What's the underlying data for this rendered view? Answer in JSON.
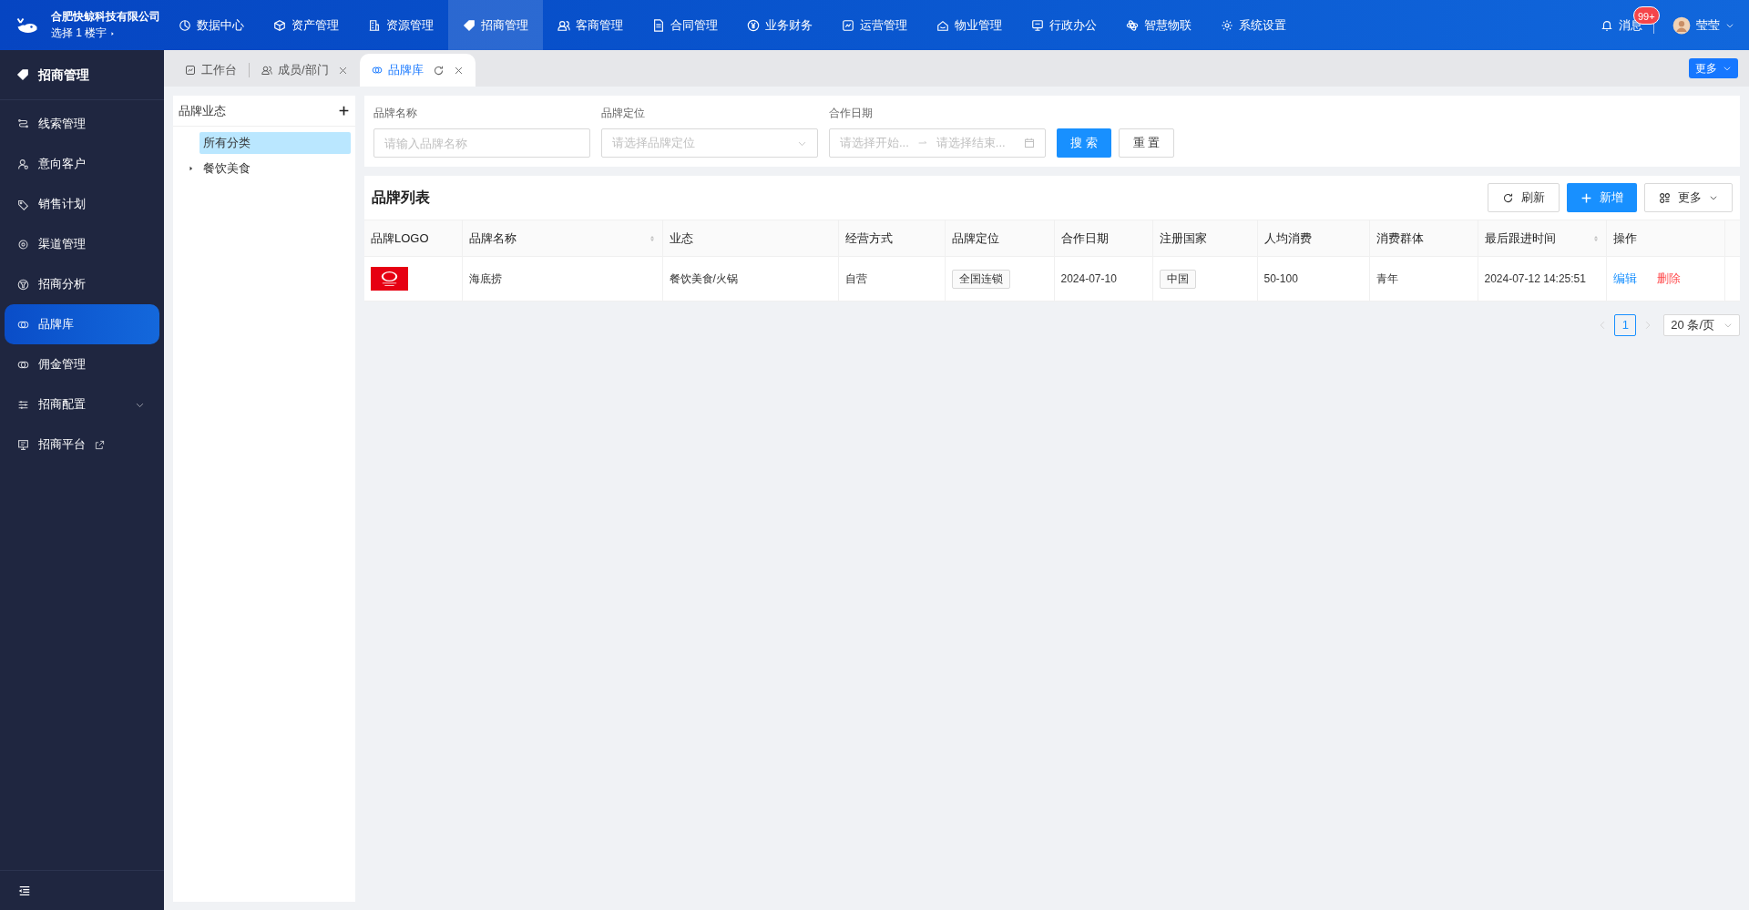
{
  "header": {
    "company": "合肥快鲸科技有限公司",
    "building_select": "选择 1 楼宇",
    "nav": [
      {
        "label": "数据中心",
        "selected": false
      },
      {
        "label": "资产管理",
        "selected": false
      },
      {
        "label": "资源管理",
        "selected": false
      },
      {
        "label": "招商管理",
        "selected": true
      },
      {
        "label": "客商管理",
        "selected": false
      },
      {
        "label": "合同管理",
        "selected": false
      },
      {
        "label": "业务财务",
        "selected": false
      },
      {
        "label": "运营管理",
        "selected": false
      },
      {
        "label": "物业管理",
        "selected": false
      },
      {
        "label": "行政办公",
        "selected": false
      },
      {
        "label": "智慧物联",
        "selected": false
      },
      {
        "label": "系统设置",
        "selected": false
      }
    ],
    "messages": "消息",
    "badge": "99+",
    "user": "莹莹"
  },
  "sidebar": {
    "title": "招商管理",
    "items": [
      {
        "label": "线索管理",
        "selected": false,
        "kind": "plain"
      },
      {
        "label": "意向客户",
        "selected": false,
        "kind": "plain"
      },
      {
        "label": "销售计划",
        "selected": false,
        "kind": "plain"
      },
      {
        "label": "渠道管理",
        "selected": false,
        "kind": "plain"
      },
      {
        "label": "招商分析",
        "selected": false,
        "kind": "plain"
      },
      {
        "label": "品牌库",
        "selected": true,
        "kind": "plain"
      },
      {
        "label": "佣金管理",
        "selected": false,
        "kind": "plain"
      },
      {
        "label": "招商配置",
        "selected": false,
        "kind": "expandable"
      },
      {
        "label": "招商平台",
        "selected": false,
        "kind": "external"
      }
    ]
  },
  "tabs": [
    {
      "label": "工作台",
      "selected": false,
      "closable": false
    },
    {
      "label": "成员/部门",
      "selected": false,
      "closable": true
    },
    {
      "label": "品牌库",
      "selected": true,
      "closable": true
    }
  ],
  "tabs_more": "更多",
  "tree": {
    "title": "品牌业态",
    "items": [
      {
        "label": "所有分类",
        "selected": true,
        "expandable": false
      },
      {
        "label": "餐饮美食",
        "selected": false,
        "expandable": true
      }
    ]
  },
  "search": {
    "fields": [
      {
        "label": "品牌名称",
        "kind": "input",
        "placeholder": "请输入品牌名称"
      },
      {
        "label": "品牌定位",
        "kind": "select",
        "placeholder": "请选择品牌定位"
      },
      {
        "label": "合作日期",
        "kind": "daterange",
        "start_placeholder": "请选择开始...",
        "end_placeholder": "请选择结束..."
      }
    ],
    "search_button": "搜 索",
    "reset_button": "重 置"
  },
  "list": {
    "title": "品牌列表",
    "refresh": "刷新",
    "add": "新增",
    "more": "更多",
    "columns": [
      {
        "label": "品牌LOGO",
        "sortable": false
      },
      {
        "label": "品牌名称",
        "sortable": true
      },
      {
        "label": "业态",
        "sortable": false
      },
      {
        "label": "经营方式",
        "sortable": false
      },
      {
        "label": "品牌定位",
        "sortable": false
      },
      {
        "label": "合作日期",
        "sortable": false
      },
      {
        "label": "注册国家",
        "sortable": false
      },
      {
        "label": "人均消费",
        "sortable": false
      },
      {
        "label": "消费群体",
        "sortable": false
      },
      {
        "label": "最后跟进时间",
        "sortable": true
      },
      {
        "label": "操作",
        "sortable": false
      }
    ],
    "rows": [
      {
        "name": "海底捞",
        "category": "餐饮美食/火锅",
        "mode": "自营",
        "positioning": "全国连锁",
        "date": "2024-07-10",
        "country": "中国",
        "spend": "50-100",
        "group": "青年",
        "last_follow": "2024-07-12 14:25:51",
        "edit": "编辑",
        "delete": "删除"
      }
    ]
  },
  "pagination": {
    "pages": [
      {
        "label": "1",
        "selected": true
      }
    ],
    "page_size": "20 条/页"
  }
}
